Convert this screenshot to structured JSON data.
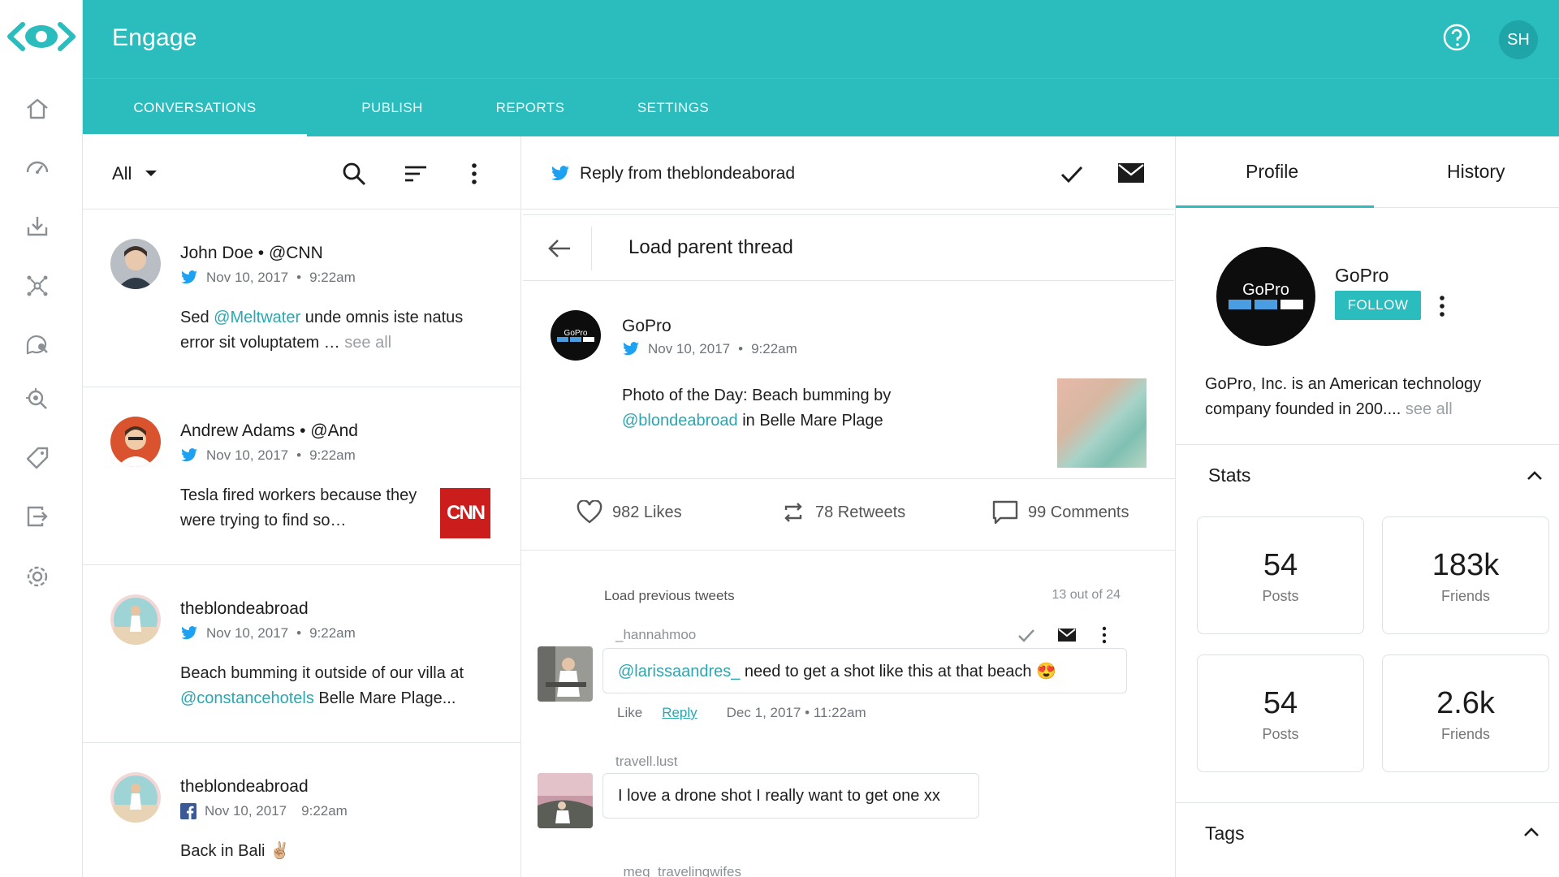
{
  "app": {
    "title": "Engage",
    "user_initials": "SH",
    "accent": "#2bbcbe"
  },
  "rail": {
    "items": [
      {
        "icon": "home-icon"
      },
      {
        "icon": "dashboard-gauge-icon"
      },
      {
        "icon": "inbox-download-icon"
      },
      {
        "icon": "network-icon"
      },
      {
        "icon": "chat-search-icon"
      },
      {
        "icon": "zoom-search-icon"
      },
      {
        "icon": "tag-icon"
      },
      {
        "icon": "export-icon"
      },
      {
        "icon": "settings-gear-icon"
      }
    ]
  },
  "tabs": [
    {
      "label": "CONVERSATIONS",
      "active": true
    },
    {
      "label": "PUBLISH",
      "active": false
    },
    {
      "label": "REPORTS",
      "active": false
    },
    {
      "label": "SETTINGS",
      "active": false
    }
  ],
  "conversations": {
    "filter": "All",
    "items": [
      {
        "name": "John Doe",
        "handle": "@CNN",
        "network": "twitter",
        "date": "Nov 10, 2017",
        "time": "9:22am",
        "text_before": "Sed ",
        "mention": "@Meltwater",
        "text_after": " unde omnis iste natus error sit voluptatem … ",
        "see_all": "see all"
      },
      {
        "name": "Andrew Adams",
        "handle": "@And",
        "network": "twitter",
        "date": "Nov 10, 2017",
        "time": "9:22am",
        "text": "Tesla fired workers because they were trying to find so…",
        "badge": "CNN"
      },
      {
        "name": "theblondeabroad",
        "network": "twitter",
        "date": "Nov 10, 2017",
        "time": "9:22am",
        "text_before": "Beach bumming it outside of our villa at ",
        "mention": "@constancehotels",
        "text_after": " Belle Mare Plage..."
      },
      {
        "name": "theblondeabroad",
        "network": "facebook",
        "date": "Nov 10, 2017",
        "time": "9:22am",
        "text": "Back in Bali ✌🏼"
      }
    ]
  },
  "thread": {
    "header": "Reply from theblondeaborad",
    "load_parent": "Load parent thread",
    "post": {
      "name": "GoPro",
      "date": "Nov 10, 2017",
      "time": "9:22am",
      "text_before": "Photo of the Day: Beach bumming by ",
      "mention": "@blondeabroad",
      "text_after": " in Belle Mare Plage"
    },
    "stats": {
      "likes": "982 Likes",
      "retweets": "78 Retweets",
      "comments": "99 Comments"
    },
    "load_previous": "Load previous tweets",
    "count": "13 out of 24",
    "replies": [
      {
        "user": "_hannahmoo",
        "mention": "@larissaandres_",
        "text": " need to get a shot like this at that beach 😍",
        "like": "Like",
        "reply": "Reply",
        "date": "Dec 1, 2017",
        "time": "11:22am"
      },
      {
        "user": "travell.lust",
        "text": "I love a drone shot I really want to get one xx"
      },
      {
        "user": "_meg_travelingwifes"
      }
    ]
  },
  "profile": {
    "tabs": [
      "Profile",
      "History"
    ],
    "name": "GoPro",
    "logo_text": "GoPro",
    "follow": "FOLLOW",
    "bio": "GoPro, Inc. is an American technology company founded in 200.... ",
    "see_all": "see all",
    "stats_title": "Stats",
    "stats": [
      {
        "value": "54",
        "label": "Posts"
      },
      {
        "value": "183k",
        "label": "Friends"
      },
      {
        "value": "54",
        "label": "Posts"
      },
      {
        "value": "2.6k",
        "label": "Friends"
      }
    ],
    "tags_title": "Tags"
  }
}
